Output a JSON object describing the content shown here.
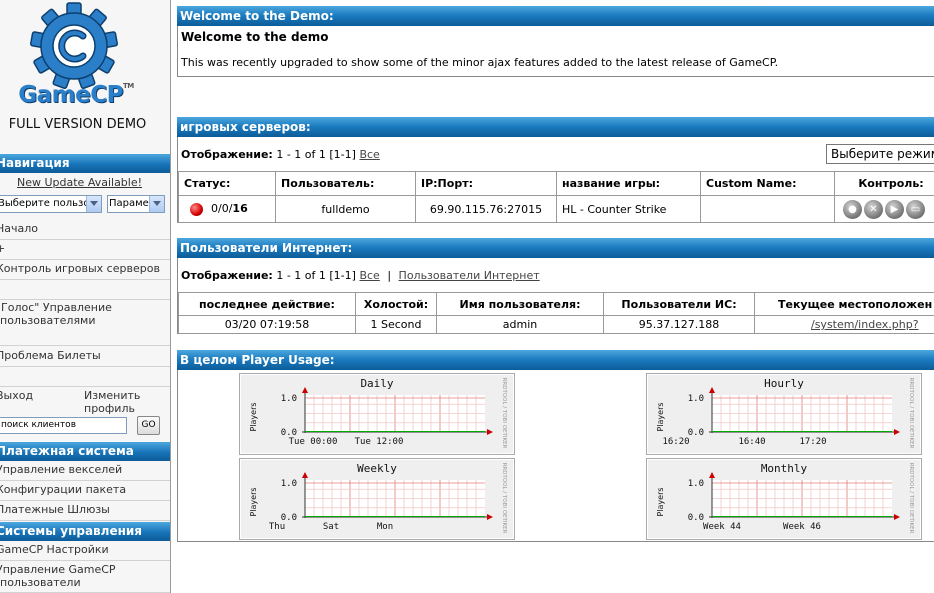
{
  "sidebar": {
    "logo_text": "GameCP",
    "logo_tm": "TM",
    "logo_subtitle": "FULL VERSION DEMO",
    "nav_header": "Навигация",
    "update_link": "New Update Available!",
    "user_select": "Выберите пользо",
    "param_select": "Параме",
    "items": [
      "Начало",
      "+",
      "Контроль игровых серверов",
      "\"Голос\" Управление пользователями",
      "Проблема Билеты"
    ],
    "logout": "Выход",
    "change_profile": "Изменить профиль",
    "search_placeholder": "поиск клиентов",
    "go_label": "GO",
    "billing_header": "Платежная система",
    "billing_items": [
      "Управление векселей",
      "Конфигурации пакета",
      "Платежные Шлюзы"
    ],
    "admin_header": "Системы управления",
    "admin_items": [
      "GameCP Настройки",
      "Управление GameCP пользователи"
    ]
  },
  "welcome": {
    "header": "Welcome to the Demo:",
    "title": "Welcome to the demo",
    "text": "This was recently upgraded to show some of the minor ajax features added to the latest release of GameCP."
  },
  "servers": {
    "header": "игровых серверов:",
    "display_label": "Отображение:",
    "display_range": "1 - 1 of 1 [1-1]",
    "all_link": "Все",
    "mode_select": "Выберите режим",
    "columns": [
      "Статус:",
      "Пользователь:",
      "IP:Порт:",
      "название игры:",
      "Custom Name:",
      "Контроль:"
    ],
    "row": {
      "status_count": "0/0/",
      "status_max": "16",
      "user": "fulldemo",
      "ip": "69.90.115.76:27015",
      "game": "HL - Counter Strike",
      "custom": ""
    }
  },
  "online": {
    "header": "Пользователи Интернет:",
    "display_label": "Отображение:",
    "display_range": "1 - 1 of 1 [1-1]",
    "all_link": "Все",
    "sep": "|",
    "users_link": "Пользователи Интернет",
    "columns": [
      "последнее действие:",
      "Холостой:",
      "Имя пользователя:",
      "Пользователи ИС:",
      "Текущее местоположен"
    ],
    "row": {
      "last": "03/20 07:19:58",
      "idle": "1 Second",
      "name": "admin",
      "ip": "95.37.127.188",
      "loc": "/system/index.php?"
    }
  },
  "usage": {
    "header": "В целом Player Usage:",
    "graphs": [
      {
        "title": "Daily",
        "ylabel": "Players",
        "y_ticks": [
          "1.0",
          "0.0"
        ],
        "x_ticks": [
          "Tue 00:00",
          "Tue 12:00"
        ],
        "side": "RRDTOOL / TOBI OETIKER"
      },
      {
        "title": "Hourly",
        "ylabel": "Players",
        "y_ticks": [
          "1.0",
          "0.0"
        ],
        "x_ticks": [
          "16:20",
          "16:40",
          "17:20"
        ],
        "side": "RRDTOOL / TOBI OETIKER"
      },
      {
        "title": "Weekly",
        "ylabel": "Players",
        "y_ticks": [
          "1.0",
          "0.0"
        ],
        "x_ticks": [
          "Thu",
          "Sat",
          "Mon"
        ],
        "side": "RRDTOOL / TOBI OETIKER"
      },
      {
        "title": "Monthly",
        "ylabel": "Players",
        "y_ticks": [
          "1.0",
          "0.0"
        ],
        "x_ticks": [
          "Week 44",
          "Week 46"
        ],
        "side": "RRDTOOL / TOBI OETIKER"
      }
    ]
  },
  "colors": {
    "header_blue": "#1a79bd",
    "status_red": "#d40000",
    "grid_red": "#f0b0b0"
  }
}
